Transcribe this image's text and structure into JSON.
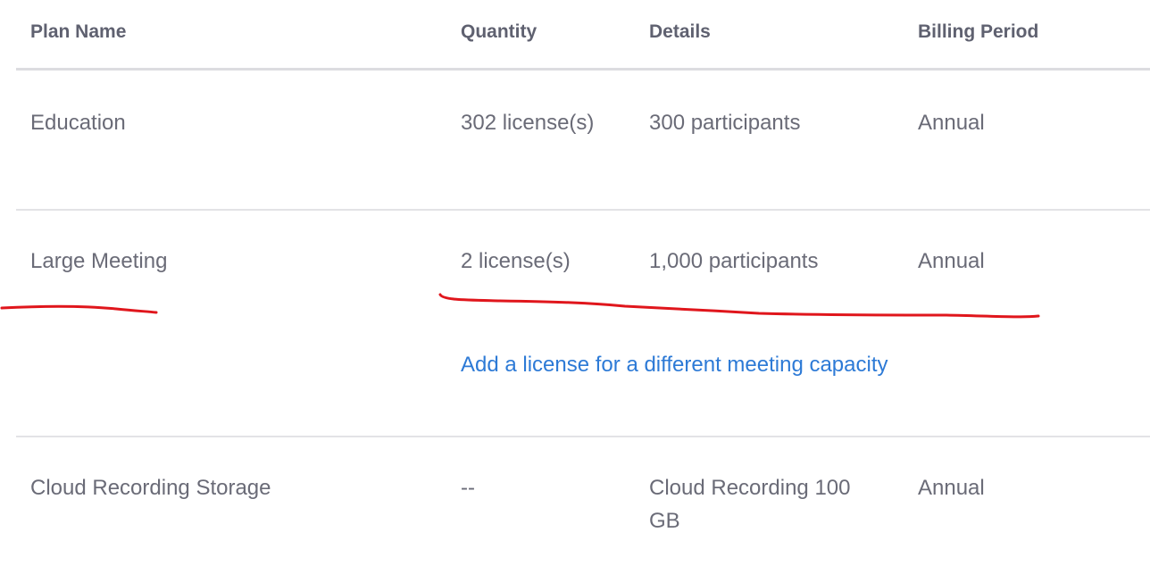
{
  "table": {
    "headers": {
      "plan_name": "Plan Name",
      "quantity": "Quantity",
      "details": "Details",
      "billing_period": "Billing Period"
    },
    "rows": [
      {
        "plan_name": "Education",
        "quantity": "302 license(s)",
        "details": "300 participants",
        "billing_period": "Annual"
      },
      {
        "plan_name": "Large Meeting",
        "quantity": "2 license(s)",
        "details": "1,000 participants",
        "billing_period": "Annual",
        "add_license_link": "Add a license for a different meeting capacity"
      },
      {
        "plan_name": "Cloud Recording Storage",
        "quantity": "--",
        "details": "Cloud Recording 100 GB",
        "billing_period": "Annual"
      }
    ]
  },
  "annotations": {
    "underline_color": "#e0161c"
  }
}
